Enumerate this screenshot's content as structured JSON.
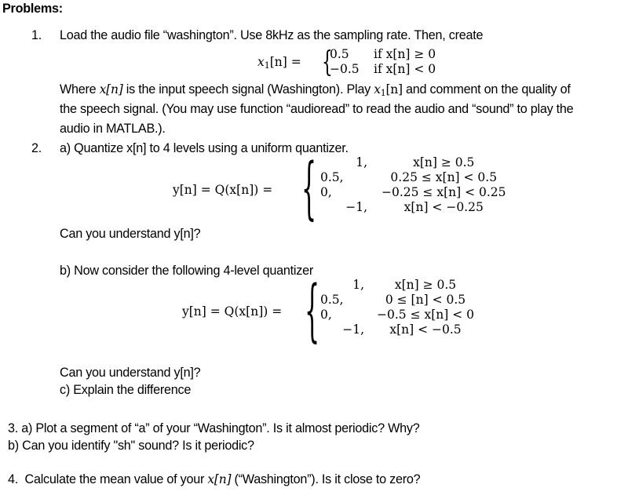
{
  "heading": "Problems:",
  "problem1": {
    "number": "1.",
    "line1": "Load the audio file “washington”. Use 8kHz as the sampling rate. Then, create",
    "equation": {
      "lhs_var": "x",
      "lhs_sub": "1",
      "lhs_arg": "[n] =",
      "cases": [
        {
          "value": "0.5",
          "condition": "if x[n] ≥ 0"
        },
        {
          "value": "−0.5",
          "condition": "if x[n] < 0"
        }
      ]
    },
    "line2": "Where x[n] is the input speech signal (Washington). Play x₁[n] and comment on the quality of",
    "line2_parts": {
      "a": "Where ",
      "b": "x[n]",
      "c": " is the input speech signal (Washington). Play ",
      "d": "x",
      "d_sub": "1",
      "e": "[n]",
      "f": " and comment on the quality of"
    },
    "line3": "the speech signal. (You may use function “audioread” to read the audio and “sound” to play the",
    "line4": "audio in MATLAB.)."
  },
  "problem2": {
    "number": "2.",
    "part_a": "a) Quantize x[n] to 4 levels using a uniform quantizer.",
    "equation_a": {
      "lhs": "y[n] = Q(x[n]) =",
      "cases": [
        {
          "value": "1,",
          "condition": "x[n] ≥ 0.5"
        },
        {
          "value": "0.5,",
          "condition": "0.25 ≤ x[n] < 0.5"
        },
        {
          "value": "0,",
          "condition": "−0.25 ≤ x[n] < 0.25"
        },
        {
          "value": "−1,",
          "condition": "x[n] < −0.25"
        }
      ]
    },
    "question_a": "Can you understand y[n]?",
    "part_b": "b) Now consider the following 4-level quantizer",
    "equation_b": {
      "lhs": "y[n] = Q(x[n]) =",
      "cases": [
        {
          "value": "1,",
          "condition": "x[n] ≥ 0.5"
        },
        {
          "value": "0.5,",
          "condition": "0 ≤ [n] < 0.5"
        },
        {
          "value": "0,",
          "condition": "−0.5 ≤ x[n] < 0"
        },
        {
          "value": "−1,",
          "condition": "x[n] < −0.5"
        }
      ]
    },
    "question_b": "Can you understand y[n]?",
    "part_c": "c) Explain the difference"
  },
  "problem3": {
    "part_a": "3. a) Plot a segment of “a” of your “Washington”. Is it almost periodic? Why?",
    "part_b": "b) Can you identify \"sh\" sound? Is it periodic?"
  },
  "problem4": {
    "number": "4.",
    "text_a": "Calculate the mean value of your ",
    "text_var": "x[n]",
    "text_b": " (“Washington”). Is it close to zero?"
  }
}
